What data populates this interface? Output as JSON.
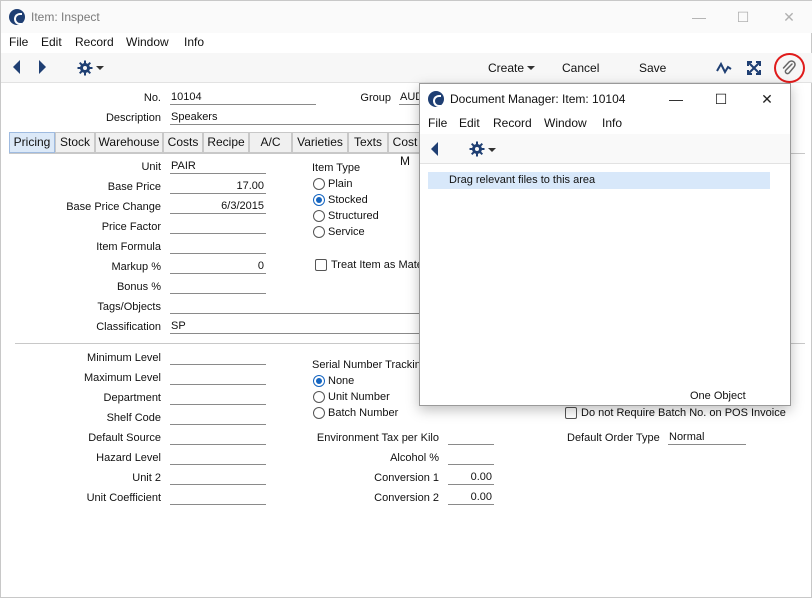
{
  "window": {
    "title": "Item: Inspect",
    "minimize": "—",
    "maximize": "☐",
    "close": "✕"
  },
  "menu": [
    "File",
    "Edit",
    "Record",
    "Window",
    "Info"
  ],
  "toolbar": {
    "create": "Create",
    "cancel": "Cancel",
    "save": "Save"
  },
  "header": {
    "no_label": "No.",
    "no_value": "10104",
    "group_label": "Group",
    "group_value": "AUD",
    "description_label": "Description",
    "description_value": "Speakers"
  },
  "tabs": [
    "Pricing",
    "Stock",
    "Warehouse",
    "Costs",
    "Recipe",
    "A/C",
    "Varieties",
    "Texts",
    "Cost M"
  ],
  "pricing": {
    "unit_label": "Unit",
    "unit_value": "PAIR",
    "base_price_label": "Base Price",
    "base_price_value": "17.00",
    "base_price_change_label": "Base Price Change",
    "base_price_change_value": "6/3/2015",
    "price_factor_label": "Price Factor",
    "price_factor_value": "",
    "item_formula_label": "Item Formula",
    "item_formula_value": "",
    "markup_label": "Markup %",
    "markup_value": "0",
    "bonus_label": "Bonus %",
    "bonus_value": "",
    "tags_label": "Tags/Objects",
    "tags_value": "",
    "classification_label": "Classification",
    "classification_value": "SP",
    "item_type_label": "Item Type",
    "item_types": [
      "Plain",
      "Stocked",
      "Structured",
      "Service"
    ],
    "item_type_selected": "Stocked",
    "treat_item_label": "Treat Item as Mate"
  },
  "lower": {
    "minimum_level_label": "Minimum Level",
    "maximum_level_label": "Maximum Level",
    "department_label": "Department",
    "shelf_code_label": "Shelf Code",
    "default_source_label": "Default Source",
    "hazard_level_label": "Hazard Level",
    "unit2_label": "Unit 2",
    "unit_coefficient_label": "Unit Coefficient",
    "serial_tracking_label": "Serial Number Tracking",
    "serial_options": [
      "None",
      "Unit Number",
      "Batch Number"
    ],
    "serial_selected": "None",
    "env_tax_label": "Environment Tax per Kilo",
    "alcohol_label": "Alcohol %",
    "conversion1_label": "Conversion 1",
    "conversion1_value": "0.00",
    "conversion2_label": "Conversion 2",
    "conversion2_value": "0.00",
    "no_batch_pos_label": "Do not Require Batch No. on POS Invoice",
    "default_order_type_label": "Default Order Type",
    "default_order_type_value": "Normal"
  },
  "doc_manager": {
    "title": "Document Manager: Item: 10104",
    "menu": [
      "File",
      "Edit",
      "Record",
      "Window",
      "Info"
    ],
    "drop_text": "Drag relevant files to this area",
    "count_text": "One Object",
    "minimize": "—",
    "maximize": "☐",
    "close": "✕"
  },
  "colors": {
    "accent": "#1565c0",
    "brand": "#1f3f73",
    "highlight_ring": "#e01b1b",
    "drop_bg": "#d8e8fa"
  }
}
